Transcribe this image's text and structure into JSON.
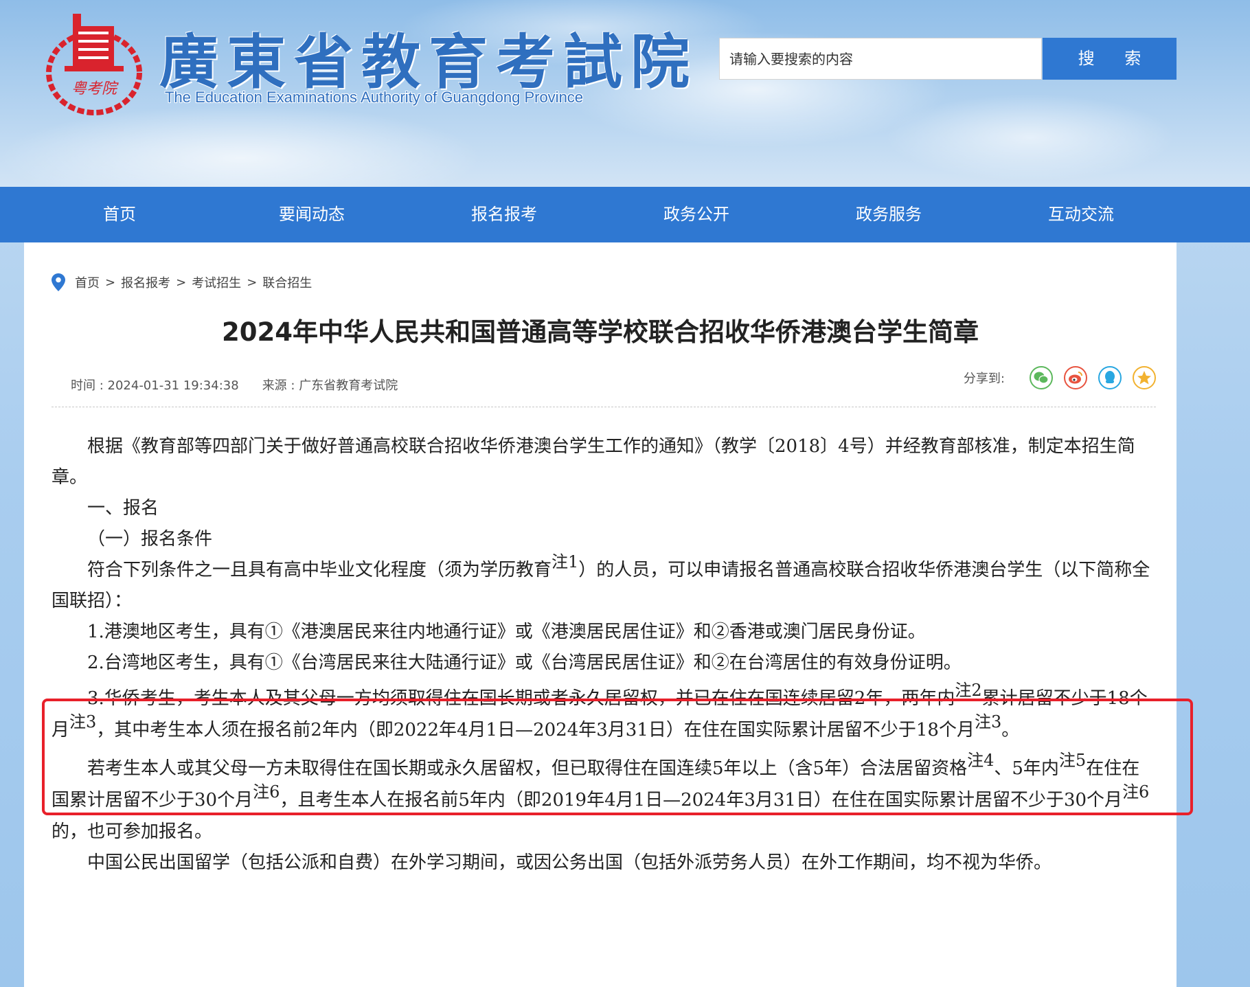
{
  "header": {
    "title_cn": "廣東省教育考試院",
    "title_en": "The Education Examinations Authority of Guangdong Province",
    "emblem_text": "粤考院",
    "search_placeholder": "请输入要搜索的内容",
    "search_button": "搜 索"
  },
  "nav": [
    "首页",
    "要闻动态",
    "报名报考",
    "政务公开",
    "政务服务",
    "互动交流"
  ],
  "breadcrumb": [
    "首页",
    "报名报考",
    "考试招生",
    "联合招生"
  ],
  "breadcrumb_sep": ">",
  "article": {
    "title": "2024年中华人民共和国普通高等学校联合招收华侨港澳台学生简章",
    "time": "时间 : 2024-01-31 19:34:38",
    "source": "来源 : 广东省教育考试院",
    "share_label": "分享到:",
    "share_icons": [
      "wechat-icon",
      "weibo-icon",
      "qq-icon",
      "qzone-icon"
    ],
    "paragraphs": {
      "p1": "根据《教育部等四部门关于做好普通高校联合招收华侨港澳台学生工作的通知》（教学〔2018〕4号）并经教育部核准，制定本招生简章。",
      "p2": "一、报名",
      "p3": "（一）报名条件",
      "p4a": "符合下列条件之一且具有高中毕业文化程度（须为学历教育",
      "p4_note": "注1",
      "p4b": "）的人员，可以申请报名普通高校联合招收华侨港澳台学生（以下简称全国联招）：",
      "p5": "1.港澳地区考生，具有①《港澳居民来往内地通行证》或《港澳居民居住证》和②香港或澳门居民身份证。",
      "p6": "2.台湾地区考生，具有①《台湾居民来往大陆通行证》或《台湾居民居住证》和②在台湾居住的有效身份证明。",
      "p7a": "3.华侨考生，考生本人及其父母一方均须取得住在国长期或者永久居留权，并已在住在国连续居留2年，两年内",
      "p7_note1": "注2",
      "p7b": "累计居留不少于18个月",
      "p7_note2": "注3",
      "p7c": "，其中考生本人须在报名前2年内（即2022年4月1日—2024年3月31日）在住在国实际累计居留不少于18个月",
      "p7_note3": "注3",
      "p7d": "。",
      "p8a": "若考生本人或其父母一方未取得住在国长期或永久居留权，但已取得住在国连续5年以上（含5年）合法居留资格",
      "p8_note1": "注4",
      "p8b": "、5年内",
      "p8_note2": "注5",
      "p8c": "在住在国累计居留不少于30个月",
      "p8_note3": "注6",
      "p8d": "，且考生本人在报名前5年内（即2019年4月1日—2024年3月31日）在住在国实际累计居留不少于30个月",
      "p8_note4": "注6",
      "p8e": "的，也可参加报名。",
      "p9": "中国公民出国留学（包括公派和自费）在外学习期间，或因公务出国（包括外派劳务人员）在外工作期间，均不视为华侨。"
    }
  },
  "colors": {
    "nav_blue": "#2f78d2",
    "highlight_red": "#e8202a",
    "emblem_red": "#d9232d"
  }
}
